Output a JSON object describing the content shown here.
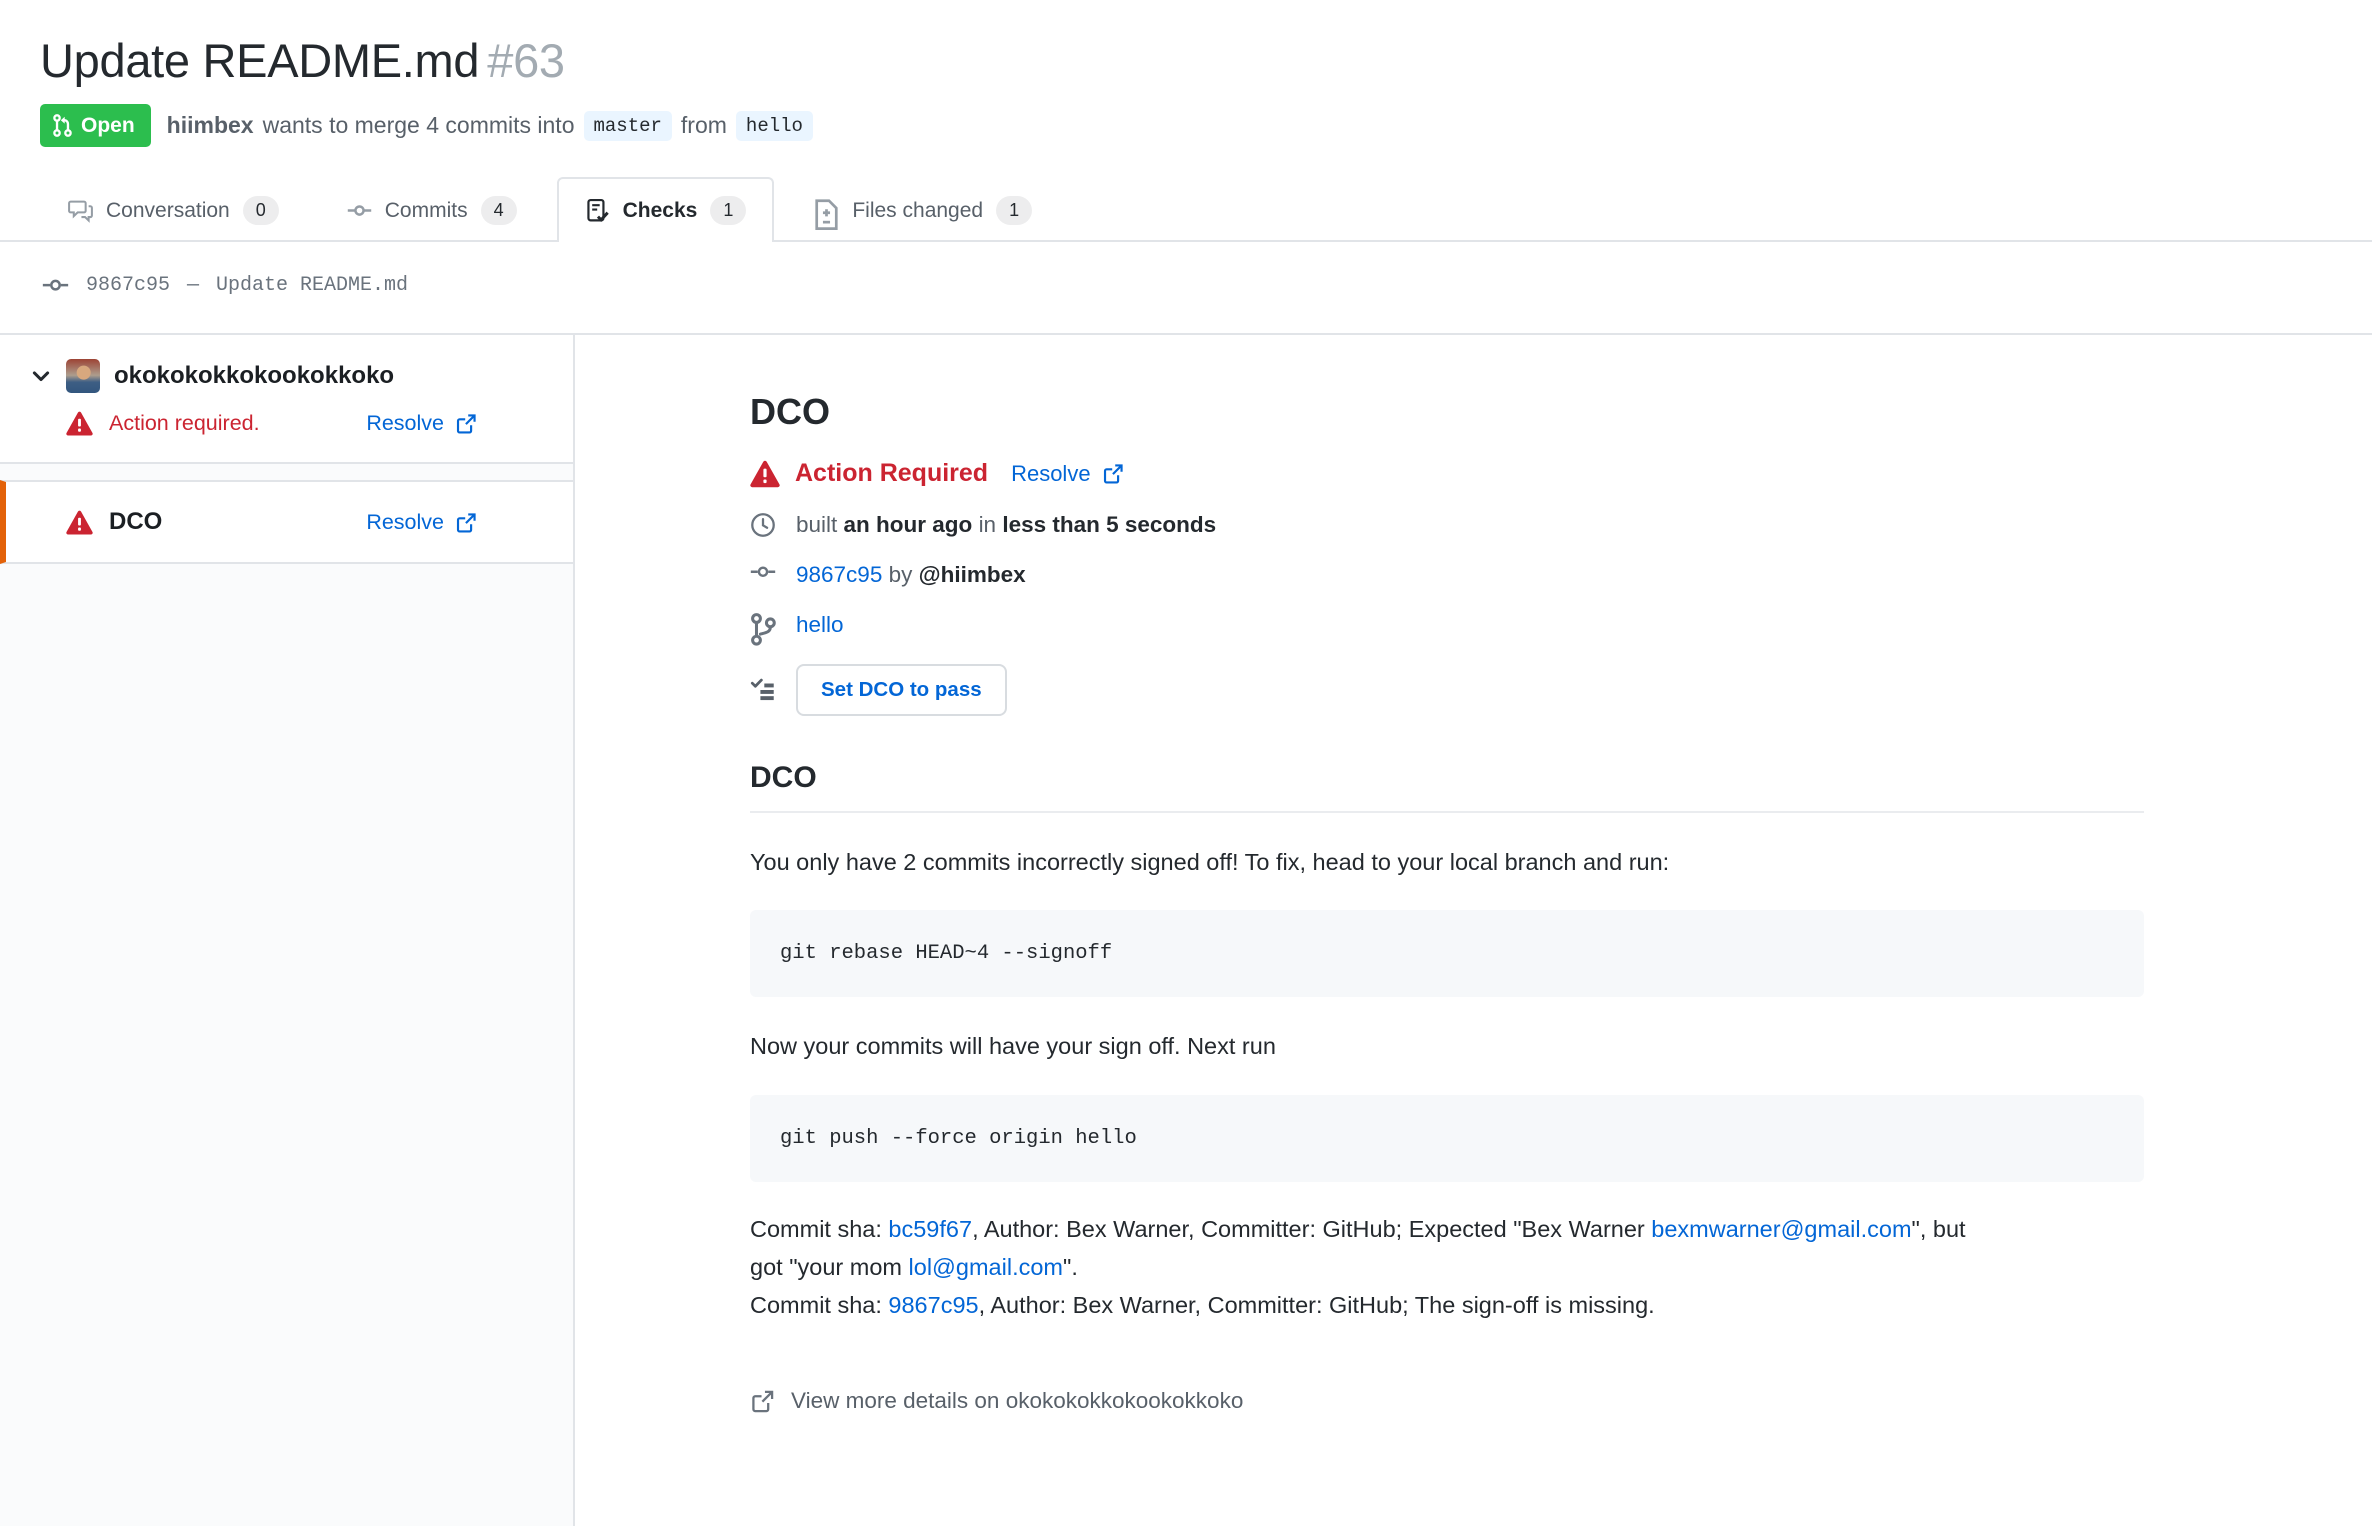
{
  "colors": {
    "accent_blue": "#0366d6",
    "open_green": "#2cbe4e",
    "danger_red": "#cb2431",
    "selected_orange": "#e36209",
    "border": "#e1e4e8",
    "muted_text": "#586069",
    "code_background": "#f6f8fa",
    "sidebar_background": "#fafbfc"
  },
  "header": {
    "title": "Update README.md",
    "number": "#63",
    "state_label": "Open",
    "author": "hiimbex",
    "merge_text_1": "wants to merge 4 commits into",
    "base_branch": "master",
    "merge_text_2": "from",
    "head_branch": "hello"
  },
  "tabs": [
    {
      "label": "Conversation",
      "count": "0",
      "icon": "comment-discussion-icon"
    },
    {
      "label": "Commits",
      "count": "4",
      "icon": "git-commit-icon"
    },
    {
      "label": "Checks",
      "count": "1",
      "icon": "checklist-icon"
    },
    {
      "label": "Files changed",
      "count": "1",
      "icon": "file-diff-icon"
    }
  ],
  "commit_bar": {
    "sha": "9867c95",
    "separator": "—",
    "message": "Update README.md"
  },
  "sidebar": {
    "suite": {
      "name": "okokokokkokookokkoko",
      "status": "Action required.",
      "resolve_label": "Resolve"
    },
    "runs": [
      {
        "name": "DCO",
        "resolve_label": "Resolve"
      }
    ]
  },
  "check": {
    "title": "DCO",
    "status_label": "Action Required",
    "resolve_label": "Resolve",
    "built_prefix": "built",
    "built_time": "an hour ago",
    "built_infix": "in",
    "built_duration": "less than 5 seconds",
    "commit_sha": "9867c95",
    "commit_by": "by",
    "commit_author": "@hiimbex",
    "branch": "hello",
    "action_button": "Set DCO to pass",
    "output": {
      "heading": "DCO",
      "p1": "You only have 2 commits incorrectly signed off! To fix, head to your local branch and run:",
      "code1": "git rebase HEAD~4 --signoff",
      "p2": "Now your commits will have your sign off. Next run",
      "code2": "git push --force origin hello",
      "sha1_a": "Commit sha: ",
      "sha1_link": "bc59f67",
      "sha1_b": ", Author: Bex Warner, Committer: GitHub; Expected \"Bex Warner ",
      "sha1_email": "bexmwarner@gmail.com",
      "sha1_c": "\", but",
      "sha1_d": "got \"your mom ",
      "sha1_email2": "lol@gmail.com",
      "sha1_e": "\".",
      "sha2_a": "Commit sha: ",
      "sha2_link": "9867c95",
      "sha2_b": ", Author: Bex Warner, Committer: GitHub; The sign-off is missing."
    },
    "footer_link": "View more details on okokokokkokookokkoko"
  }
}
